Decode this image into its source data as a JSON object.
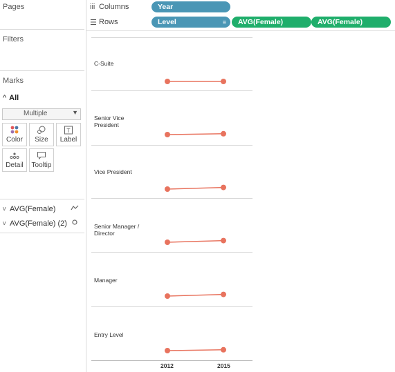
{
  "left": {
    "pages_title": "Pages",
    "filters_title": "Filters",
    "marks_title": "Marks",
    "marks_all": "All",
    "mark_type": "Multiple",
    "buttons": {
      "color": "Color",
      "size": "Size",
      "label": "Label",
      "detail": "Detail",
      "tooltip": "Tooltip"
    },
    "cards": [
      {
        "label": "AVG(Female)",
        "icon": "line-mark-icon"
      },
      {
        "label": "AVG(Female) (2)",
        "icon": "circle-mark-icon"
      }
    ]
  },
  "shelves": {
    "columns": {
      "name": "Columns",
      "pill": "Year"
    },
    "rows": {
      "name": "Rows",
      "pills": [
        "Level",
        "AVG(Female)",
        "AVG(Female)"
      ]
    }
  },
  "chart_data": {
    "type": "line",
    "x": [
      "2012",
      "2015"
    ],
    "rows": [
      "C-Suite",
      "Senior Vice\nPresident",
      "Vice President",
      "Senior Manager /\nDirector",
      "Manager",
      "Entry Level"
    ],
    "row_labels": {
      "r0": "C-Suite",
      "r1a": "Senior Vice",
      "r1b": "President",
      "r2": "Vice President",
      "r3a": "Senior Manager /",
      "r3b": "Director",
      "r4": "Manager",
      "r5": "Entry Level"
    },
    "series": [
      {
        "name": "",
        "values": [
          [
            0.17,
            0.17
          ],
          [
            0.23,
            0.24
          ],
          [
            0.3,
            0.32
          ],
          [
            0.32,
            0.34
          ],
          [
            0.37,
            0.39
          ],
          [
            0.45,
            0.46
          ]
        ]
      }
    ],
    "colors": {
      "line": "#e8735e",
      "point": "#e8735e"
    }
  }
}
